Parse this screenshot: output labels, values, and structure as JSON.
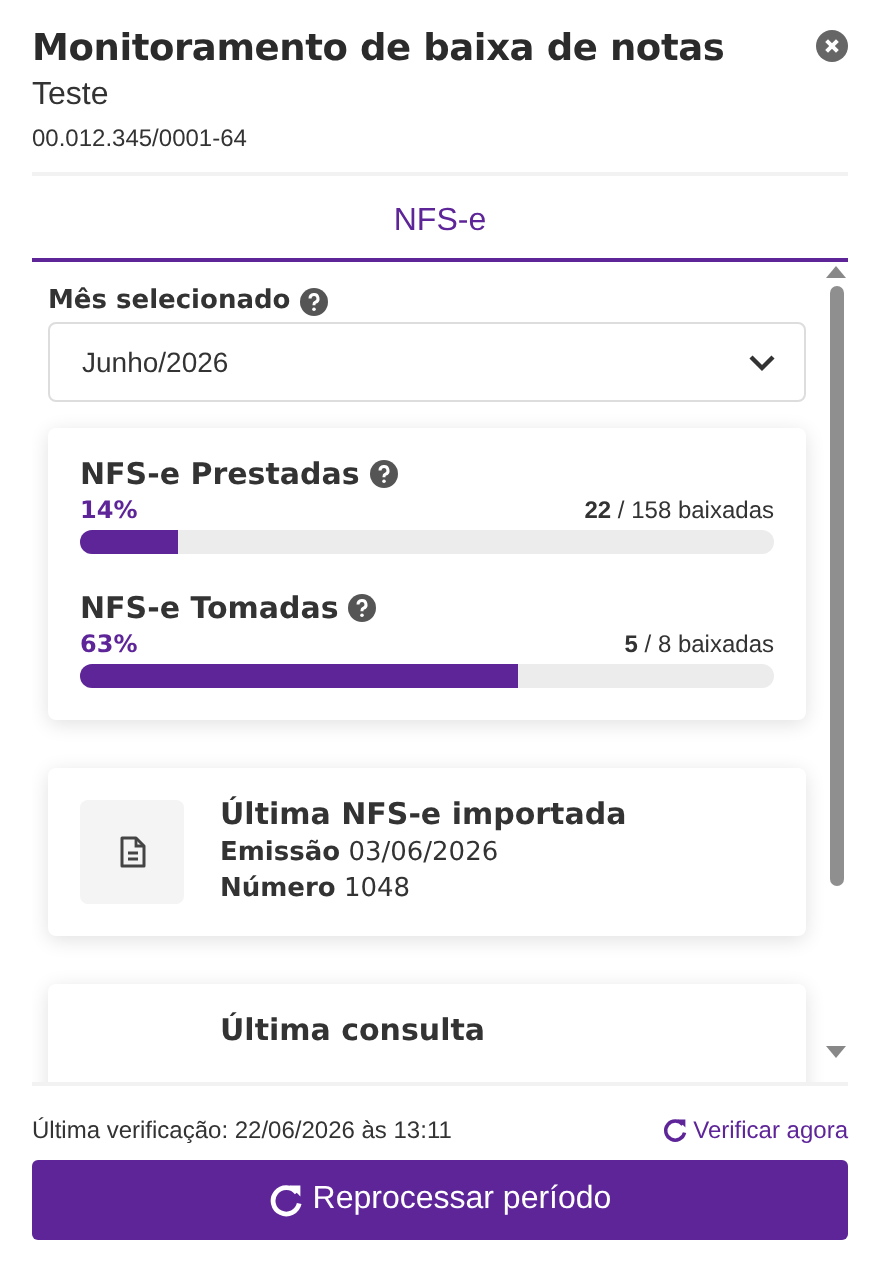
{
  "header": {
    "title": "Monitoramento de baixa de notas",
    "subtitle": "Teste",
    "document": "00.012.345/0001-64"
  },
  "tabs": [
    {
      "label": "NFS-e",
      "selected": true
    }
  ],
  "month": {
    "label": "Mês selecionado",
    "value": "Junho/2026"
  },
  "progress": [
    {
      "title": "NFS-e Prestadas",
      "percent": "14%",
      "count": "**22** / 158 baixadas",
      "level": 0.14
    },
    {
      "title": "NFS-e Tomadas",
      "percent": "63%",
      "count": "**5** / 8 baixadas",
      "level": 0.63
    }
  ],
  "cards": [
    {
      "title": "Última NFS-e importada",
      "lines": [
        "**Emissão** 03/06/2026",
        "**Número** 1048"
      ]
    },
    {
      "title": "Última consulta"
    }
  ],
  "footer": {
    "last_check": "Última verificação: 22/06/2026 às 13:11",
    "check_now": "Verificar agora",
    "reprocess": "Reprocessar período"
  }
}
